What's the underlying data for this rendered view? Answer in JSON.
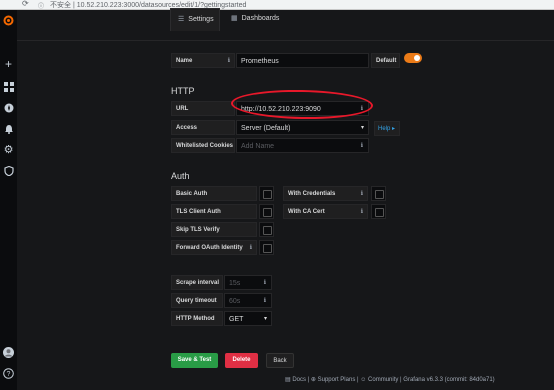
{
  "browser": {
    "url": "10.52.210.223:3000/datasources/edit/1/?gettingstarted",
    "security": "不安全"
  },
  "tabs": [
    {
      "label": "Settings",
      "icon": "sliders-icon",
      "active": true
    },
    {
      "label": "Dashboards",
      "icon": "apps-icon",
      "active": false
    }
  ],
  "name_field": {
    "label": "Name",
    "value": "Prometheus",
    "default_label": "Default",
    "default_on": true
  },
  "http": {
    "title": "HTTP",
    "url_label": "URL",
    "url_value": "http://10.52.210.223:9090",
    "access_label": "Access",
    "access_value": "Server (Default)",
    "help_label": "Help ▸",
    "whitelisted_label": "Whitelisted Cookies",
    "whitelisted_placeholder": "Add Name"
  },
  "auth": {
    "title": "Auth",
    "basic_auth": "Basic Auth",
    "with_credentials": "With Credentials",
    "tls_client_auth": "TLS Client Auth",
    "with_ca_cert": "With CA Cert",
    "skip_tls": "Skip TLS Verify",
    "forward_oauth": "Forward OAuth Identity"
  },
  "prom": {
    "scrape_label": "Scrape interval",
    "scrape_placeholder": "15s",
    "timeout_label": "Query timeout",
    "timeout_placeholder": "60s",
    "method_label": "HTTP Method",
    "method_value": "GET"
  },
  "buttons": {
    "save": "Save & Test",
    "delete": "Delete",
    "back": "Back"
  },
  "footer": {
    "docs": "Docs",
    "support": "Support Plans",
    "community": "Community",
    "version": "Grafana v6.3.3 (commit: 84d0a71)"
  },
  "colors": {
    "accent": "#eb7b18",
    "save": "#299c46",
    "delete": "#e02f44",
    "annotation": "#e8182a"
  }
}
